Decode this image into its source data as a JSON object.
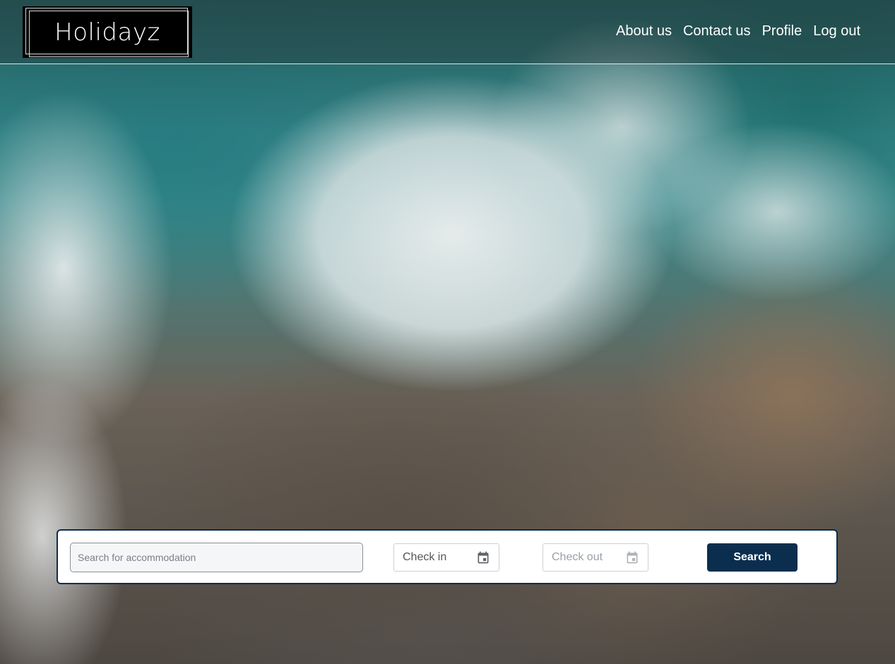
{
  "header": {
    "logo_text": "Holidayz",
    "nav": [
      {
        "label": "About us"
      },
      {
        "label": "Contact us"
      },
      {
        "label": "Profile"
      },
      {
        "label": "Log out"
      }
    ]
  },
  "search": {
    "placeholder": "Search for accommodation",
    "value": "",
    "check_in_label": "Check in",
    "check_out_label": "Check out",
    "button_label": "Search"
  },
  "colors": {
    "accent": "#0b2e4f",
    "logo_bg": "#000000"
  },
  "icons": {
    "calendar": "calendar-icon"
  }
}
